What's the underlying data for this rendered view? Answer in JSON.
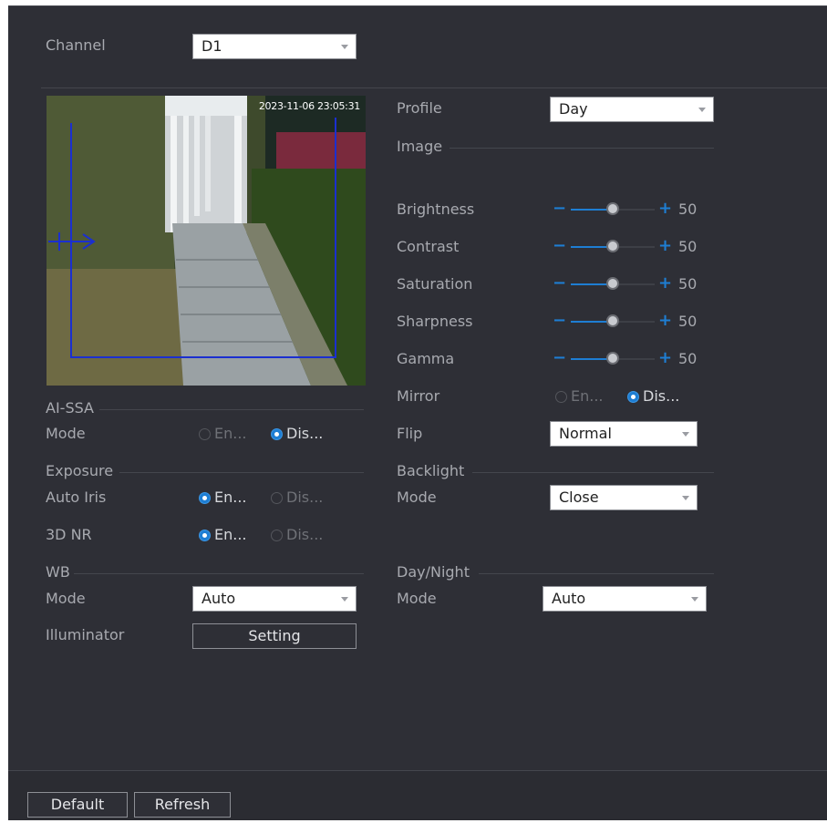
{
  "channel": {
    "label": "Channel",
    "value": "D1"
  },
  "preview": {
    "timestamp": "2023-11-06 23:05:31"
  },
  "profile": {
    "label": "Profile",
    "value": "Day"
  },
  "image": {
    "section": "Image",
    "brightness": {
      "label": "Brightness",
      "value": "50",
      "level_pct": 50
    },
    "contrast": {
      "label": "Contrast",
      "value": "50",
      "level_pct": 50
    },
    "saturation": {
      "label": "Saturation",
      "value": "50",
      "level_pct": 50
    },
    "sharpness": {
      "label": "Sharpness",
      "value": "50",
      "level_pct": 50
    },
    "gamma": {
      "label": "Gamma",
      "value": "50",
      "level_pct": 50
    },
    "mirror": {
      "label": "Mirror",
      "option_enable": "En...",
      "option_disable": "Dis...",
      "selected": "disable"
    },
    "flip": {
      "label": "Flip",
      "value": "Normal"
    }
  },
  "ai_ssa": {
    "section": "AI-SSA",
    "mode_label": "Mode",
    "option_enable": "En...",
    "option_disable": "Dis...",
    "selected": "disable"
  },
  "exposure": {
    "section": "Exposure",
    "auto_iris": {
      "label": "Auto Iris",
      "option_enable": "En...",
      "option_disable": "Dis...",
      "selected": "enable"
    },
    "nr3d": {
      "label": "3D NR",
      "option_enable": "En...",
      "option_disable": "Dis...",
      "selected": "enable"
    }
  },
  "wb": {
    "section": "WB",
    "mode_label": "Mode",
    "mode_value": "Auto",
    "illuminator_label": "Illuminator",
    "setting_button": "Setting"
  },
  "backlight": {
    "section": "Backlight",
    "mode_label": "Mode",
    "mode_value": "Close"
  },
  "daynight": {
    "section": "Day/Night",
    "mode_label": "Mode",
    "mode_value": "Auto"
  },
  "footer": {
    "default_button": "Default",
    "refresh_button": "Refresh"
  },
  "colors": {
    "accent": "#1e7ed3",
    "panel_bg": "#2e2f36"
  },
  "icons": {
    "dropdown": "caret-down-icon",
    "decrease": "minus-icon",
    "increase": "plus-icon"
  }
}
